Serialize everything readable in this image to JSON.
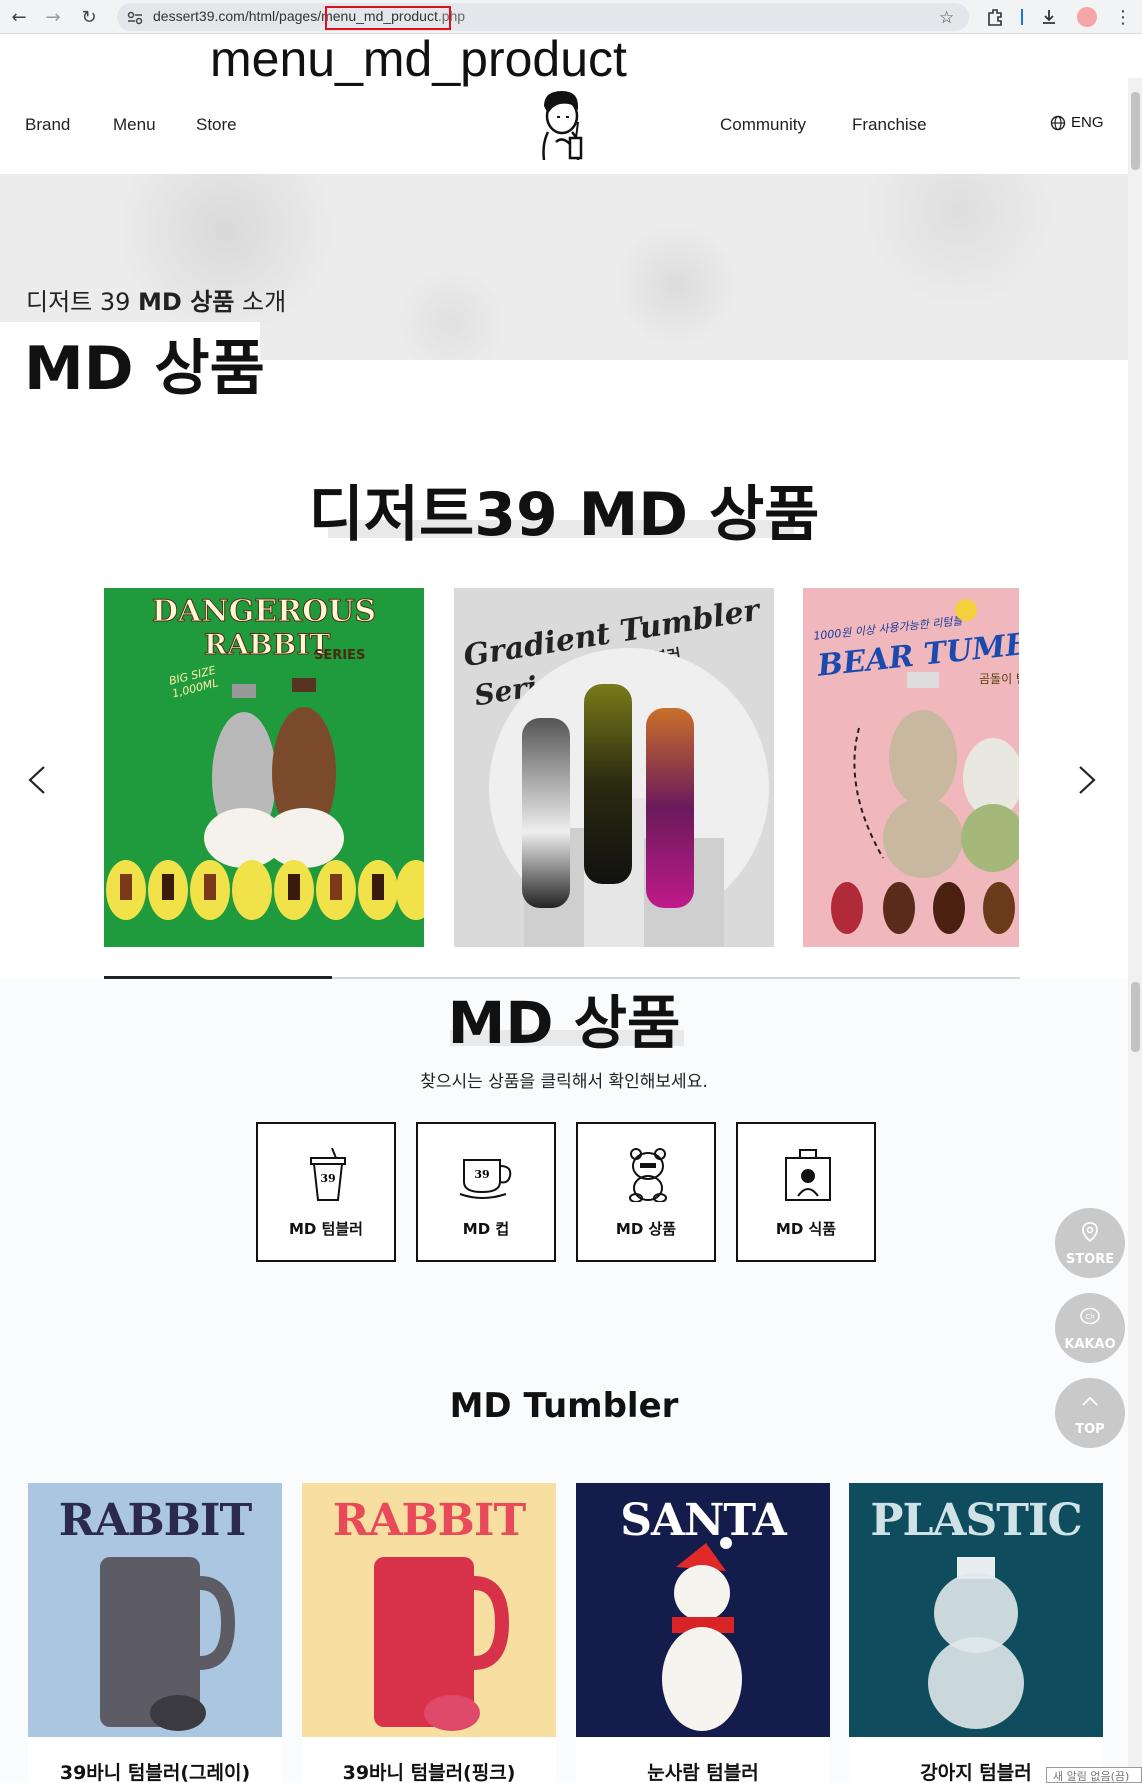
{
  "browser": {
    "url_host": "dessert39.com/html/pages/",
    "url_page": "menu_md_product",
    "url_ext": ".php"
  },
  "overlay_label": "menu_md_product",
  "nav": {
    "left": [
      "Brand",
      "Menu",
      "Store"
    ],
    "right": [
      "Community",
      "Franchise"
    ],
    "lang": "ENG"
  },
  "hero": {
    "subtitle_prefix": "디저트 39 ",
    "subtitle_bold": "MD 상품",
    "subtitle_suffix": " 소개",
    "title": "MD 상품"
  },
  "featured": {
    "title": "디저트39 MD 상품",
    "slides": [
      {
        "line1": "DANGEROUS",
        "line2": "RABBIT",
        "tag": "SERIES",
        "badge": "BIG SIZE 1,000ML",
        "bg": "#1f9a3c"
      },
      {
        "line1": "Gradient Tumbler",
        "line2": "Series",
        "tag": "그라데이션 텀블러",
        "bg": "#d9d9d9"
      },
      {
        "line1": "BEAR TUMBLER",
        "tag": "1000원 이상 사용가능한 리텀블",
        "badge": "곰돌이 텀블러",
        "bg": "#f0b8bd"
      }
    ]
  },
  "md_section": {
    "title": "MD 상품",
    "description": "찾으시는 상품을 클릭해서 확인해보세요.",
    "categories": [
      "MD 텀블러",
      "MD 컵",
      "MD 상품",
      "MD 식품"
    ]
  },
  "floating": {
    "store": "STORE",
    "kakao": "KAKAO",
    "top": "TOP"
  },
  "tumbler_section": {
    "title": "MD Tumbler",
    "products": [
      {
        "word": "RABBIT",
        "name": "39바니 텀블러(그레이)",
        "bg": "#aac6e0",
        "word_color": "#2b2a4c"
      },
      {
        "word": "RABBIT",
        "name": "39바니 텀블러(핑크)",
        "bg": "#f7dfa1",
        "word_color": "#e94a5a"
      },
      {
        "word": "SANTA",
        "name": "눈사람 텀블러",
        "bg": "#141c4c",
        "word_color": "#ffffff"
      },
      {
        "word": "PLASTIC",
        "name": "강아지 텀블러",
        "bg": "#0f4d5e",
        "word_color": "#cfe3e6"
      }
    ]
  },
  "toast": "새 알림 없음(끔)"
}
